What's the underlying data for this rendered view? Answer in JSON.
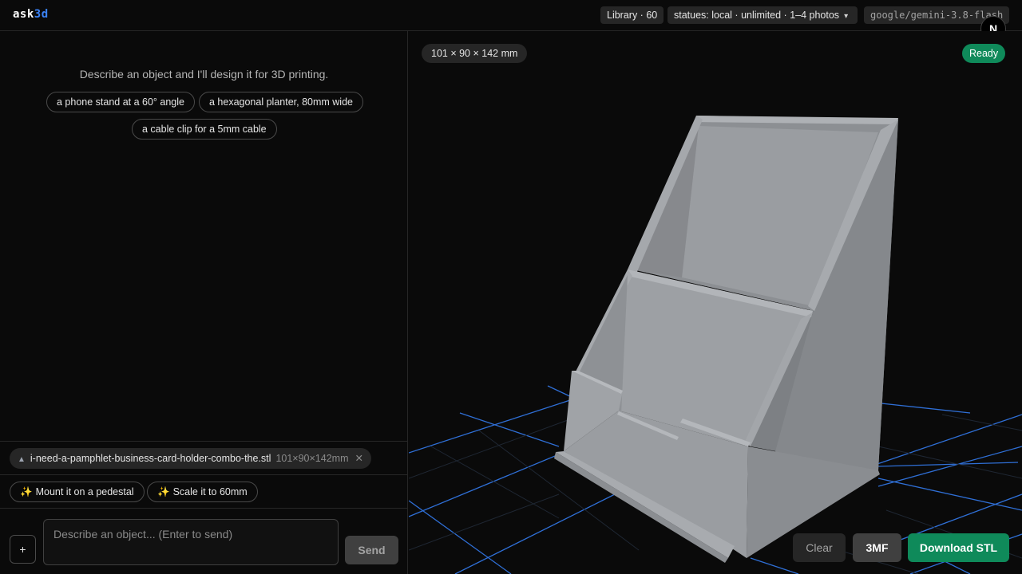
{
  "app": {
    "logo_main": "ask",
    "logo_accent": "3d"
  },
  "header": {
    "library": "Library · 60",
    "mode_select": "statues: local · unlimited · 1–4 photos",
    "model": "google/gemini-3.8-flash",
    "avatar": "N"
  },
  "chat": {
    "intro": "Describe an object and I'll design it for 3D printing.",
    "examples": [
      "a phone stand at a 60° angle",
      "a hexagonal planter, 80mm wide",
      "a cable clip for a 5mm cable"
    ],
    "attachment": {
      "name": "i-need-a-pamphlet-business-card-holder-combo-the.stl",
      "dims": "101×90×142mm"
    },
    "suggestions": [
      "Mount it on a pedestal",
      "Scale it to 60mm"
    ],
    "input_placeholder": "Describe an object... (Enter to send)",
    "plus_label": "+",
    "send_label": "Send"
  },
  "viewer": {
    "dimensions": "101 × 90 × 142 mm",
    "status": "Ready",
    "clear_label": "Clear",
    "export_3mf_label": "3MF",
    "download_label": "Download STL"
  },
  "colors": {
    "accent": "#3b82f6",
    "success": "#0f8a5a",
    "grid": "#2f6fd6",
    "model": "#9a9da1"
  }
}
